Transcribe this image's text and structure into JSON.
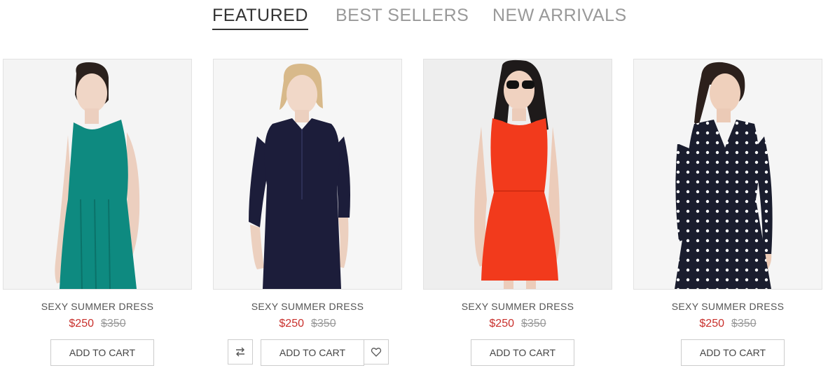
{
  "tabs": [
    {
      "label": "FEATURED",
      "active": true
    },
    {
      "label": "BEST SELLERS",
      "active": false
    },
    {
      "label": "NEW ARRIVALS",
      "active": false
    }
  ],
  "products": [
    {
      "name": "SEXY SUMMER DRESS",
      "price": "$250",
      "old_price": "$350",
      "cart_label": "ADD TO CART",
      "dress_color": "#0e8a80",
      "image": "woman-in-teal-sleeveless-dress"
    },
    {
      "name": "SEXY SUMMER DRESS",
      "price": "$250",
      "old_price": "$350",
      "cart_label": "ADD TO CART",
      "dress_color": "#1c1d3a",
      "image": "woman-in-navy-shirt-dress",
      "compare_icon": "compare-arrows-icon",
      "wishlist_icon": "heart-icon"
    },
    {
      "name": "SEXY SUMMER DRESS",
      "price": "$250",
      "old_price": "$350",
      "cart_label": "ADD TO CART",
      "dress_color": "#f23a1c",
      "image": "woman-in-red-dress-with-sunglasses"
    },
    {
      "name": "SEXY SUMMER DRESS",
      "price": "$250",
      "old_price": "$350",
      "cart_label": "ADD TO CART",
      "dress_color": "#1a1d2e",
      "image": "woman-in-polka-dot-wrap-dress"
    }
  ],
  "colors": {
    "sale_price": "#c9302c",
    "old_price": "#999999",
    "active_tab": "#333333",
    "inactive_tab": "#999999"
  }
}
